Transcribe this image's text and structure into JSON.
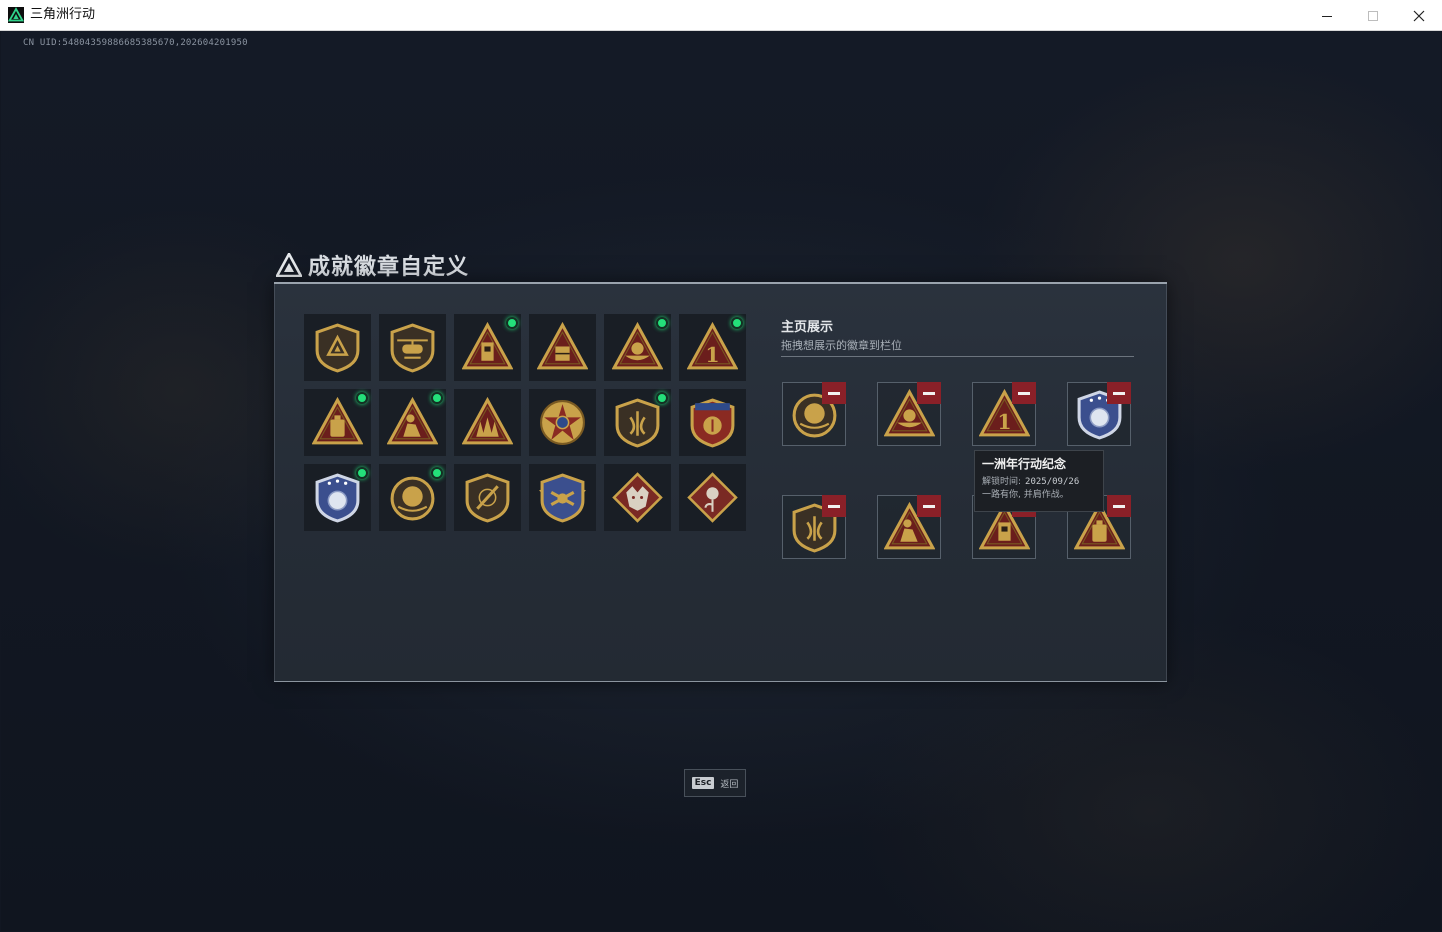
{
  "window": {
    "title": "三角洲行动"
  },
  "uid": "CN UID:54804359886685385670,202604201950",
  "page": {
    "title": "成就徽章自定义"
  },
  "badges": [
    {
      "icon": "shield-delta-badge-icon",
      "new": false
    },
    {
      "icon": "helicopter-badge-icon",
      "new": false
    },
    {
      "icon": "triangle-tower-badge-icon",
      "new": true
    },
    {
      "icon": "triangle-crate-badge-icon",
      "new": false
    },
    {
      "icon": "triangle-boat-badge-icon",
      "new": true
    },
    {
      "icon": "triangle-number-one-badge-icon",
      "new": true
    },
    {
      "icon": "triangle-canister-badge-icon",
      "new": true
    },
    {
      "icon": "triangle-soldier-badge-icon",
      "new": true
    },
    {
      "icon": "triangle-squad-badge-icon",
      "new": false
    },
    {
      "icon": "star-emblem-badge-icon",
      "new": false
    },
    {
      "icon": "shield-wing-badge-icon",
      "new": true
    },
    {
      "icon": "stars-crest-badge-icon",
      "new": false
    },
    {
      "icon": "blue-crest-badge-icon",
      "new": true
    },
    {
      "icon": "round-helmet-badge-icon",
      "new": true
    },
    {
      "icon": "shield-blade-badge-icon",
      "new": false
    },
    {
      "icon": "winged-shield-badge-icon",
      "new": false
    },
    {
      "icon": "diamond-wolf-badge-icon",
      "new": false
    },
    {
      "icon": "diamond-rose-badge-icon",
      "new": false
    }
  ],
  "showcase": {
    "title": "主页展示",
    "subtitle": "拖拽想展示的徽章到栏位",
    "slots": [
      {
        "icon": "round-helmet-badge-icon"
      },
      {
        "icon": "triangle-boat-badge-icon"
      },
      {
        "icon": "triangle-number-one-badge-icon"
      },
      {
        "icon": "blue-crest-badge-icon"
      },
      {
        "icon": "shield-wing-badge-icon"
      },
      {
        "icon": "triangle-soldier-badge-icon"
      },
      {
        "icon": "triangle-tower-badge-icon"
      },
      {
        "icon": "triangle-canister-badge-icon"
      }
    ]
  },
  "tooltip": {
    "title": "一洲年行动纪念",
    "unlock_label": "解锁时间:",
    "unlock_date": "2025/09/26",
    "desc": "一路有你, 并肩作战。"
  },
  "footer": {
    "esc_key": "Esc",
    "esc_label": "返回"
  },
  "colors": {
    "accent_green": "#24e07a",
    "remove_red": "#8a2028",
    "gold": "#c9a24a"
  }
}
